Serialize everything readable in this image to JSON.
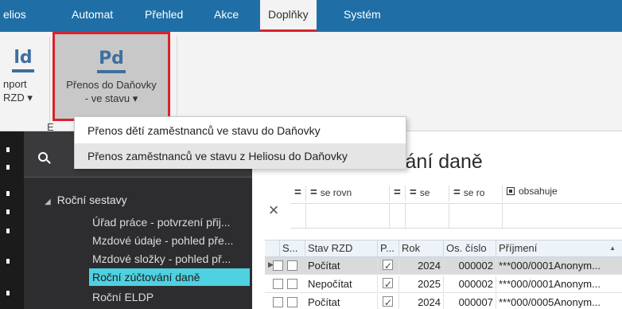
{
  "menu": {
    "items": [
      {
        "label": "elios"
      },
      {
        "label": "Automat"
      },
      {
        "label": "Přehled"
      },
      {
        "label": "Akce"
      },
      {
        "label": "Doplňky"
      },
      {
        "label": "Systém"
      }
    ]
  },
  "ribbon": {
    "import_btn": {
      "icon_text": "ld",
      "label_line1": "nport",
      "label_line2": "RZD ▾"
    },
    "transfer_btn": {
      "icon_text": "Pd",
      "label_line1": "Přenos do Daňovky",
      "label_line2": "- ve stavu ▾"
    },
    "group_label_fragment": "E"
  },
  "dropdown": {
    "items": [
      {
        "label": "Přenos dětí zaměstnanců ve stavu do Daňovky"
      },
      {
        "label": "Přenos zaměstnanců ve stavu z Heliosu do Daňovky"
      }
    ]
  },
  "nav": {
    "group_label": "Roční sestavy",
    "items": [
      {
        "label": "Úřad práce - potvrzení přij..."
      },
      {
        "label": "Mzdové údaje - pohled pře..."
      },
      {
        "label": "Mzdové složky - pohled př..."
      },
      {
        "label": "Roční zúčtování daně"
      },
      {
        "label": "Roční ELDP"
      }
    ]
  },
  "main": {
    "title": "Roční zúčtování daně"
  },
  "filter": {
    "clear_icon": "×",
    "cells": [
      {
        "op": "=",
        "text": ""
      },
      {
        "op": "=",
        "text": "se rovn"
      },
      {
        "op": "=",
        "text": ""
      },
      {
        "op": "=",
        "text": "se"
      },
      {
        "op": "=",
        "text": "se ro"
      },
      {
        "op": "",
        "text": "obsahuje"
      }
    ]
  },
  "grid": {
    "columns": [
      "S...",
      "Stav RZD",
      "P...",
      "Rok",
      "Os. číslo",
      "Příjmení"
    ],
    "rows": [
      {
        "stav": "Počítat",
        "p": true,
        "rok": "2024",
        "os": "000002",
        "prijmeni": "***000/0001Anonym..."
      },
      {
        "stav": "Nepočítat",
        "p": true,
        "rok": "2025",
        "os": "000002",
        "prijmeni": "***000/0001Anonym..."
      },
      {
        "stav": "Počítat",
        "p": true,
        "rok": "2024",
        "os": "000007",
        "prijmeni": "***000/0005Anonym..."
      }
    ]
  },
  "colors": {
    "menubar": "#1f6fa6",
    "accent_red": "#d9232d",
    "nav_selected": "#4ed1e0",
    "nav_bg": "#2d2d30"
  }
}
